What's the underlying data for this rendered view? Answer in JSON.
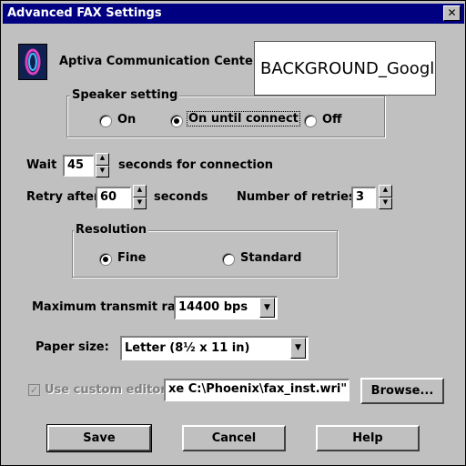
{
  "window": {
    "title": "Advanced FAX Settings",
    "close_glyph": "✕"
  },
  "header": {
    "app_name": "Aptiva Communication Center",
    "background_label": "BACKGROUND_Google"
  },
  "speaker": {
    "legend": "Speaker setting",
    "options": [
      {
        "label": "On",
        "selected": false
      },
      {
        "label": "On until connect",
        "selected": true
      },
      {
        "label": "Off",
        "selected": false
      }
    ]
  },
  "wait": {
    "label": "Wait",
    "value": "45",
    "suffix": "seconds for connection"
  },
  "retry": {
    "label": "Retry after",
    "value": "60",
    "suffix": "seconds"
  },
  "retries": {
    "label": "Number of retries",
    "value": "3"
  },
  "resolution": {
    "legend": "Resolution",
    "options": [
      {
        "label": "Fine",
        "selected": true
      },
      {
        "label": "Standard",
        "selected": false
      }
    ]
  },
  "transmit": {
    "label": "Maximum transmit rate:",
    "value": "14400 bps"
  },
  "paper": {
    "label": "Paper size:",
    "value": "Letter (8½ x 11 in)"
  },
  "editor": {
    "label": "Use custom editor:",
    "checked": true,
    "path": "xe  C:\\Phoenix\\fax_inst.wri\"",
    "browse_label": "Browse..."
  },
  "buttons": {
    "save": "Save",
    "cancel": "Cancel",
    "help": "Help"
  }
}
